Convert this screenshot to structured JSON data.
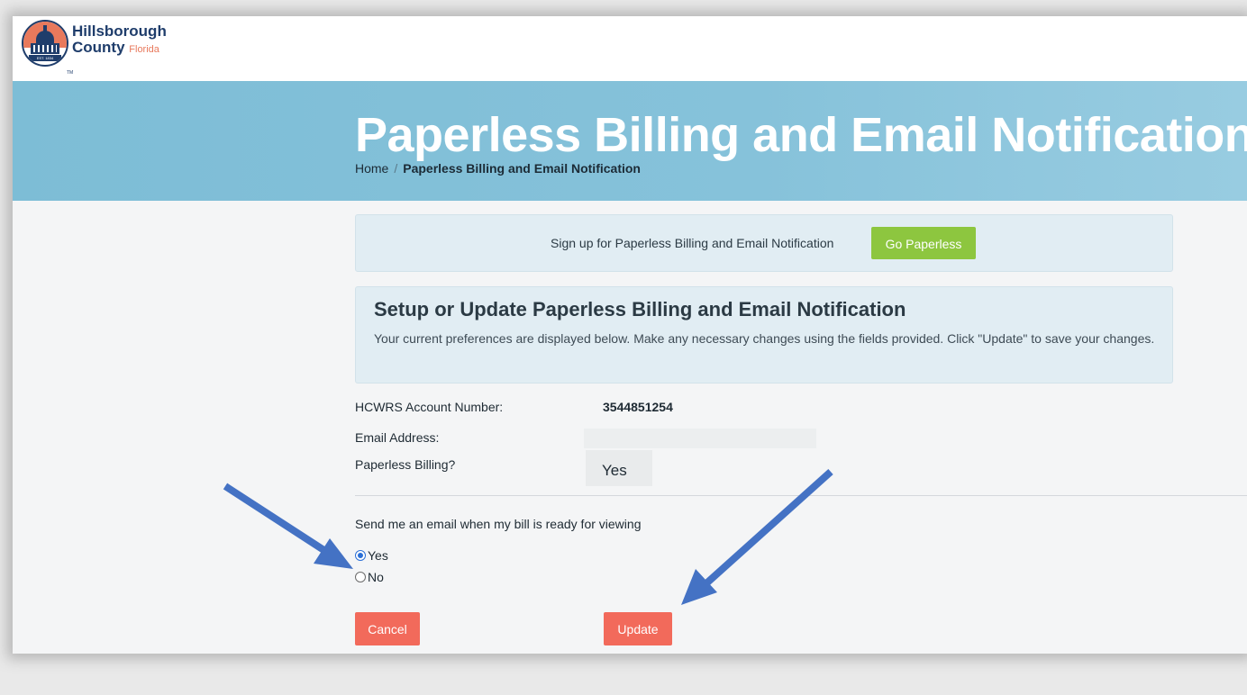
{
  "brand": {
    "line1": "Hillsborough",
    "line2": "County",
    "state": "Florida",
    "seal_text": "EST. 1834",
    "tm": "TM"
  },
  "hero": {
    "title": "Paperless Billing and Email Notification",
    "breadcrumb": {
      "home": "Home",
      "separator": "/",
      "current": "Paperless Billing and Email Notification"
    }
  },
  "banner": {
    "message": "Sign up for Paperless Billing and Email Notification",
    "button": "Go Paperless"
  },
  "panel": {
    "title": "Setup or Update Paperless Billing and Email Notification",
    "description": "Your current preferences are displayed below. Make any necessary changes using the fields provided. Click \"Update\" to save your changes."
  },
  "account": {
    "account_label": "HCWRS Account Number:",
    "account_value": "3544851254",
    "email_label": "Email Address:",
    "paperless_label": "Paperless Billing?",
    "paperless_value": "Yes"
  },
  "notify": {
    "prompt": "Send me an email when my bill is ready for viewing",
    "options": [
      {
        "label": "Yes",
        "selected": true
      },
      {
        "label": "No",
        "selected": false
      }
    ]
  },
  "actions": {
    "cancel": "Cancel",
    "update": "Update"
  },
  "colors": {
    "hero_bg": "#86c2da",
    "go_button": "#8dc63f",
    "action_button": "#f26a5b",
    "arrow": "#4472c4",
    "brand_navy": "#1f3d6b",
    "brand_orange": "#e8795c"
  }
}
